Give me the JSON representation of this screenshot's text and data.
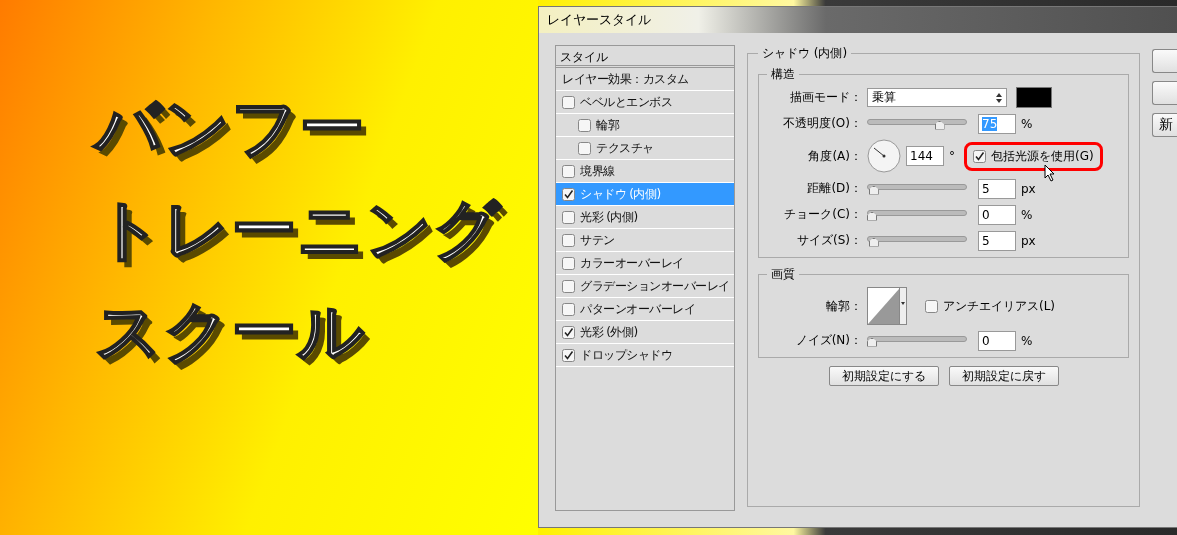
{
  "banner": {
    "lines": [
      "バンフー",
      "トレーニング",
      "スクール"
    ]
  },
  "dialog": {
    "title": "レイヤースタイル",
    "styles_panel": {
      "header": "スタイル",
      "subheader": "レイヤー効果：カスタム",
      "items": [
        {
          "label": "ベベルとエンボス",
          "checked": false,
          "selected": false,
          "children": [
            {
              "label": "輪郭",
              "checked": false,
              "selected": false
            },
            {
              "label": "テクスチャ",
              "checked": false,
              "selected": false
            }
          ]
        },
        {
          "label": "境界線",
          "checked": false,
          "selected": false
        },
        {
          "label": "シャドウ (内側)",
          "checked": true,
          "selected": true
        },
        {
          "label": "光彩 (内側)",
          "checked": false,
          "selected": false
        },
        {
          "label": "サテン",
          "checked": false,
          "selected": false
        },
        {
          "label": "カラーオーバーレイ",
          "checked": false,
          "selected": false
        },
        {
          "label": "グラデーションオーバーレイ",
          "checked": false,
          "selected": false
        },
        {
          "label": "パターンオーバーレイ",
          "checked": false,
          "selected": false
        },
        {
          "label": "光彩 (外側)",
          "checked": true,
          "selected": false
        },
        {
          "label": "ドロップシャドウ",
          "checked": true,
          "selected": false
        }
      ]
    },
    "section_title": "シャドウ (内側)",
    "structure": {
      "title": "構造",
      "rows": [
        {
          "kind": "select",
          "label": "描画モード：",
          "value": "乗算"
        },
        {
          "kind": "slider",
          "label": "不透明度(O)：",
          "value": "75",
          "unit": "%",
          "level": 0.75,
          "value_selected": true
        },
        {
          "kind": "angle",
          "label": "角度(A)：",
          "value": "144",
          "unit": "°",
          "option": {
            "label": "包括光源を使用(G)",
            "checked": true,
            "highlighted": true
          }
        },
        {
          "kind": "slider",
          "label": "距離(D)：",
          "value": "5",
          "unit": "px",
          "level": 0.02,
          "value_selected": false
        },
        {
          "kind": "slider",
          "label": "チョーク(C)：",
          "value": "0",
          "unit": "%",
          "level": 0,
          "value_selected": false
        },
        {
          "kind": "slider",
          "label": "サイズ(S)：",
          "value": "5",
          "unit": "px",
          "level": 0.02,
          "value_selected": false
        }
      ]
    },
    "quality": {
      "title": "画質",
      "contour_label": "輪郭：",
      "anti_alias": {
        "label": "アンチエイリアス(L)",
        "checked": false
      },
      "noise": {
        "kind": "slider",
        "label": "ノイズ(N)：",
        "value": "0",
        "unit": "%",
        "level": 0,
        "value_selected": false
      }
    },
    "buttons": [
      "初期設定にする",
      "初期設定に戻す"
    ],
    "side_button_label": "新"
  }
}
